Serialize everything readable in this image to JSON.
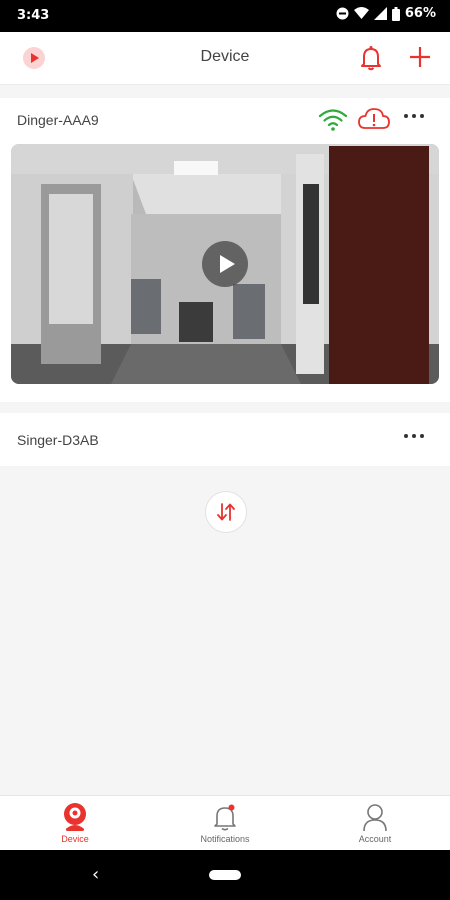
{
  "status_bar": {
    "time": "3:43",
    "battery": "66%"
  },
  "app_bar": {
    "title": "Device"
  },
  "devices": [
    {
      "name": "Dinger-AAA9"
    },
    {
      "name": "Singer-D3AB"
    }
  ],
  "bottom_nav": {
    "items": [
      {
        "label": "Device",
        "icon": "camera-icon",
        "active": true
      },
      {
        "label": "Notifications",
        "icon": "bell-icon",
        "active": false
      },
      {
        "label": "Account",
        "icon": "person-icon",
        "active": false
      }
    ]
  },
  "colors": {
    "accent": "#e8332e",
    "wifi": "#2eaa3a"
  }
}
